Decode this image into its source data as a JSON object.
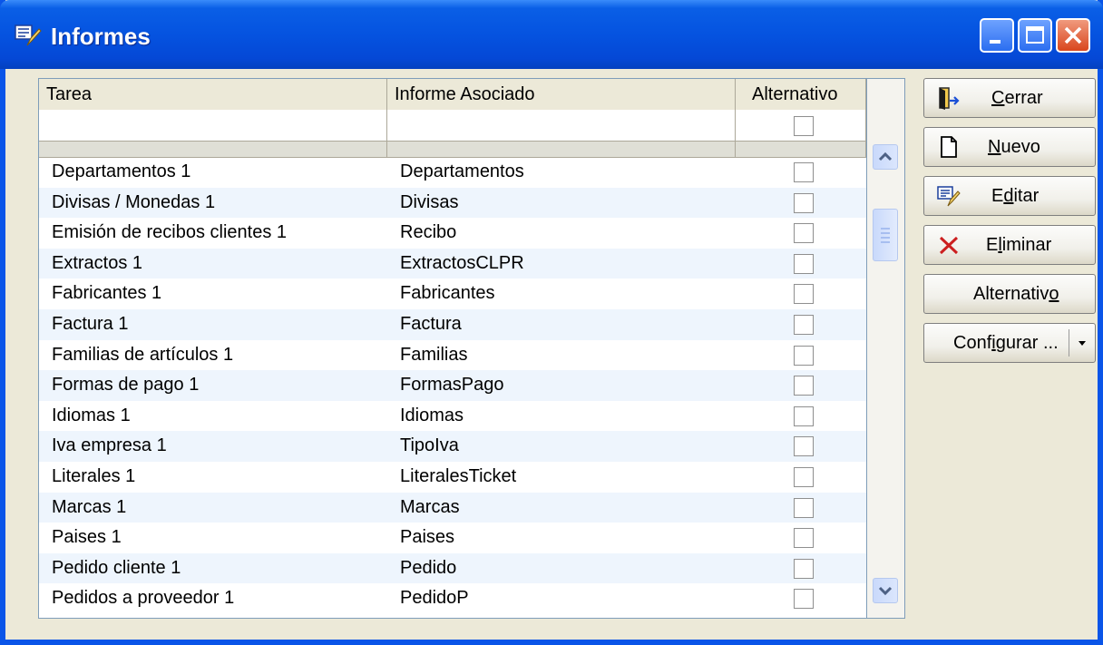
{
  "window": {
    "title": "Informes",
    "icon": "report-edit-icon"
  },
  "grid": {
    "columns": [
      "Tarea",
      "Informe Asociado",
      "Alternativo"
    ],
    "rows": [
      {
        "tarea": "Departamentos 1",
        "informe": "Departamentos",
        "alternativo": false
      },
      {
        "tarea": "Divisas / Monedas 1",
        "informe": "Divisas",
        "alternativo": false
      },
      {
        "tarea": "Emisión de recibos clientes 1",
        "informe": "Recibo",
        "alternativo": false
      },
      {
        "tarea": "Extractos 1",
        "informe": "ExtractosCLPR",
        "alternativo": false
      },
      {
        "tarea": "Fabricantes 1",
        "informe": "Fabricantes",
        "alternativo": false
      },
      {
        "tarea": "Factura 1",
        "informe": "Factura",
        "alternativo": false
      },
      {
        "tarea": "Familias de artículos 1",
        "informe": "Familias",
        "alternativo": false
      },
      {
        "tarea": "Formas de pago 1",
        "informe": "FormasPago",
        "alternativo": false
      },
      {
        "tarea": "Idiomas 1",
        "informe": "Idiomas",
        "alternativo": false
      },
      {
        "tarea": "Iva empresa 1",
        "informe": "TipoIva",
        "alternativo": false
      },
      {
        "tarea": "Literales 1",
        "informe": "LiteralesTicket",
        "alternativo": false
      },
      {
        "tarea": "Marcas 1",
        "informe": "Marcas",
        "alternativo": false
      },
      {
        "tarea": "Paises 1",
        "informe": "Paises",
        "alternativo": false
      },
      {
        "tarea": "Pedido cliente 1",
        "informe": "Pedido",
        "alternativo": false
      },
      {
        "tarea": "Pedidos a proveedor 1",
        "informe": "PedidoP",
        "alternativo": false
      }
    ]
  },
  "buttons": {
    "cerrar": {
      "pre": "",
      "u": "C",
      "post": "errar",
      "icon": "exit-door-icon"
    },
    "nuevo": {
      "pre": "",
      "u": "N",
      "post": "uevo",
      "icon": "new-document-icon"
    },
    "editar": {
      "pre": "E",
      "u": "d",
      "post": "itar",
      "icon": "edit-report-icon"
    },
    "eliminar": {
      "pre": "E",
      "u": "l",
      "post": "iminar",
      "icon": "delete-x-icon"
    },
    "alternativo": {
      "pre": "Alternativ",
      "u": "o",
      "post": ""
    },
    "configurar": {
      "pre": "Conf",
      "u": "i",
      "post": "gurar ...",
      "icon": "dropdown-arrow-icon"
    }
  },
  "colors": {
    "titlebar": "#0553e0",
    "row_alt": "#eef5fd",
    "face": "#ece9d8",
    "close_button": "#d9461d"
  }
}
